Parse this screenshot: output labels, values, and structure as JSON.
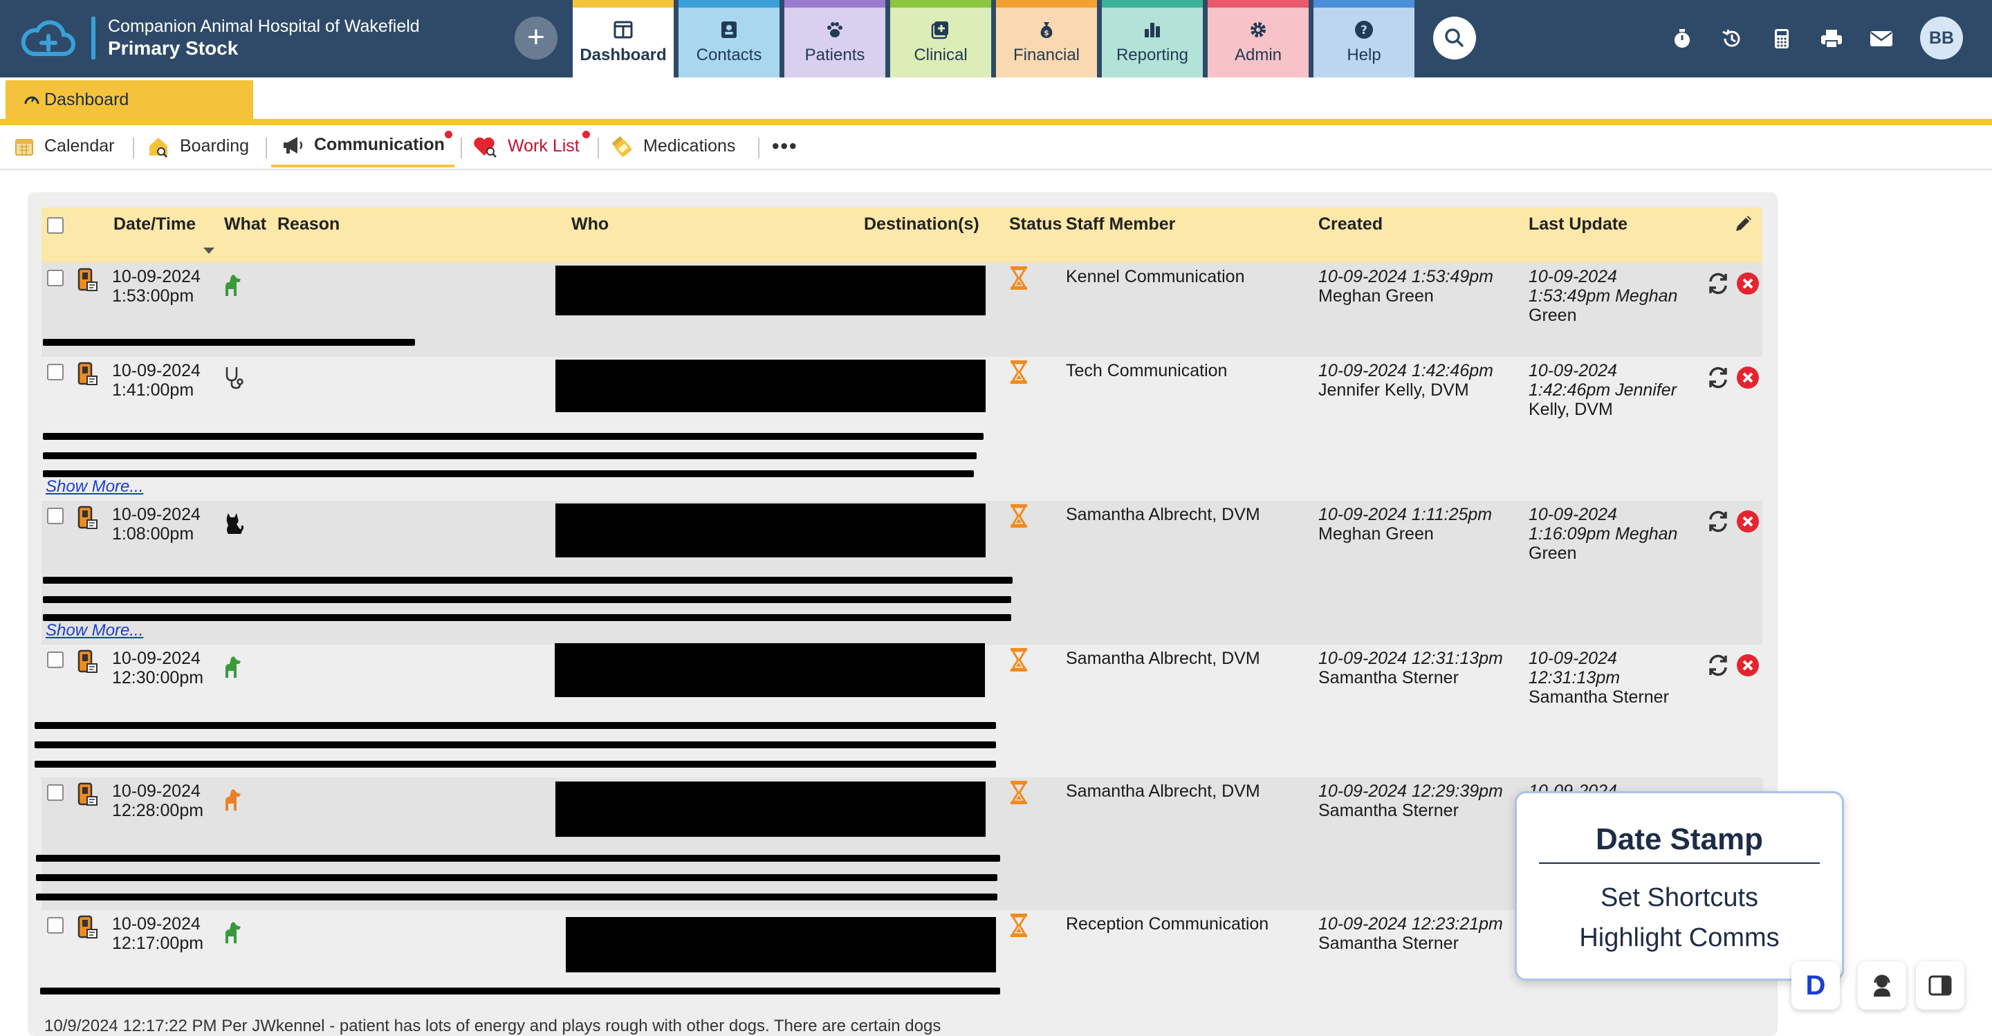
{
  "header": {
    "clinic_name": "Companion Animal Hospital of Wakefield",
    "module_name": "Primary Stock",
    "add_label": "+",
    "tabs": [
      {
        "label": "Dashboard",
        "icon": "dashboard-icon",
        "color": "#f5c33b"
      },
      {
        "label": "Contacts",
        "icon": "contact-card-icon",
        "color": "#3aa0d8"
      },
      {
        "label": "Patients",
        "icon": "paw-icon",
        "color": "#9b7bd0"
      },
      {
        "label": "Clinical",
        "icon": "medical-plus-icon",
        "color": "#8cc63f"
      },
      {
        "label": "Financial",
        "icon": "money-bag-icon",
        "color": "#f5a132"
      },
      {
        "label": "Reporting",
        "icon": "bar-chart-icon",
        "color": "#3ab39a"
      },
      {
        "label": "Admin",
        "icon": "gear-icon",
        "color": "#ea5a6b"
      },
      {
        "label": "Help",
        "icon": "question-icon",
        "color": "#4a90d9"
      }
    ],
    "avatar_initials": "BB"
  },
  "dashboard": {
    "title": "Dashboard"
  },
  "subnav": {
    "items": [
      {
        "label": "Calendar",
        "icon": "calendar-icon"
      },
      {
        "label": "Boarding",
        "icon": "boarding-house-icon"
      },
      {
        "label": "Communication",
        "icon": "megaphone-icon",
        "active": true,
        "badge": true
      },
      {
        "label": "Work List",
        "icon": "heart-icon",
        "badge": true
      },
      {
        "label": "Medications",
        "icon": "pill-bottle-icon"
      }
    ],
    "more_label": "•••"
  },
  "table": {
    "columns": {
      "datetime": "Date/Time",
      "what": "What",
      "reason": "Reason",
      "who": "Who",
      "destinations": "Destination(s)",
      "status": "Status",
      "staff": "Staff Member",
      "created": "Created",
      "last_update": "Last Update"
    },
    "show_more_label": "Show More...",
    "rows": [
      {
        "date": "10-09-2024",
        "time": "1:53:00pm",
        "species": "dog",
        "species_color": "#3a9a3a",
        "staff": "Kennel Communication",
        "created_date": "10-09-2024 1:53:49pm",
        "created_by": "Meghan Green",
        "updated_line1": "10-09-2024",
        "updated_line2": "1:53:49pm Meghan",
        "updated_line3": "Green"
      },
      {
        "date": "10-09-2024",
        "time": "1:41:00pm",
        "species": "stethoscope",
        "species_color": "#333333",
        "staff": "Tech Communication",
        "created_date": "10-09-2024 1:42:46pm",
        "created_by": "Jennifer Kelly, DVM",
        "updated_line1": "10-09-2024",
        "updated_line2": "1:42:46pm Jennifer",
        "updated_line3": "Kelly, DVM"
      },
      {
        "date": "10-09-2024",
        "time": "1:08:00pm",
        "species": "cat",
        "species_color": "#111111",
        "staff": "Samantha Albrecht, DVM",
        "created_date": "10-09-2024 1:11:25pm",
        "created_by": "Meghan Green",
        "updated_line1": "10-09-2024",
        "updated_line2": "1:16:09pm Meghan",
        "updated_line3": "Green"
      },
      {
        "date": "10-09-2024",
        "time": "12:30:00pm",
        "species": "dog",
        "species_color": "#3a9a3a",
        "staff": "Samantha Albrecht, DVM",
        "created_date": "10-09-2024 12:31:13pm",
        "created_by": "Samantha Sterner",
        "updated_line1": "10-09-2024",
        "updated_line2": "12:31:13pm",
        "updated_line3": "Samantha Sterner"
      },
      {
        "date": "10-09-2024",
        "time": "12:28:00pm",
        "species": "dog",
        "species_color": "#e8822a",
        "staff": "Samantha Albrecht, DVM",
        "created_date": "10-09-2024 12:29:39pm",
        "created_by": "Samantha Sterner",
        "updated_line1": "10-09-2024",
        "updated_line2": "",
        "updated_line3": ""
      },
      {
        "date": "10-09-2024",
        "time": "12:17:00pm",
        "species": "dog",
        "species_color": "#3a9a3a",
        "staff": "Reception Communication",
        "created_date": "10-09-2024 12:23:21pm",
        "created_by": "Samantha Sterner",
        "updated_line1": "",
        "updated_line2": "",
        "updated_line3": ""
      }
    ],
    "last_note": "10/9/2024 12:17:22 PM Per JWkennel - patient has lots of energy and plays rough with other dogs. There are certain dogs"
  },
  "date_stamp_popup": {
    "title": "Date Stamp",
    "items": [
      "Set Shortcuts",
      "Highlight Comms"
    ]
  },
  "floating": {
    "d_label": "D"
  },
  "colors": {
    "topbar": "#2f4a68",
    "dashboard_accent": "#f5c33b",
    "header_row": "#fce8a8",
    "status_hourglass": "#f08c1e",
    "delete_red": "#e4252f"
  }
}
